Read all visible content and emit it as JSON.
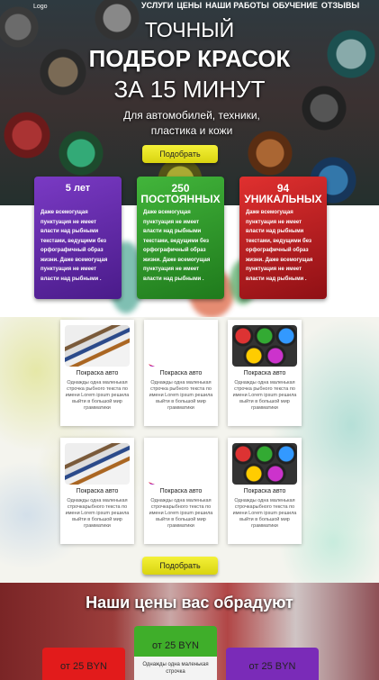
{
  "header": {
    "logo": "Logo",
    "nav": [
      "УСЛУГИ",
      "ЦЕНЫ",
      "НАШИ РАБОТЫ",
      "ОБУЧЕНИЕ",
      "ОТЗЫВЫ"
    ]
  },
  "hero": {
    "line1": "ТОЧНЫЙ",
    "line2": "ПОДБОР КРАСОК",
    "line3": "ЗА 15 МИНУТ",
    "sub": "Для автомобилей, техники, пластика и кожи",
    "button": "Подобрать"
  },
  "features": [
    {
      "title": "5 лет",
      "text": "Даже всемогущая пунктуация не имеет власти над рыбными текстами, ведущими без орфографичный образ жизни. Даже всемогущая пунктуация не имеет власти над рыбными .",
      "color": "#6a2bb0"
    },
    {
      "title": "250 ПОСТОЯННЫХ",
      "text": "Даже всемогущая пунктуация не имеет власти над рыбными текстами, ведущими без орфографичный образ жизни. Даже всемогущая пунктуация не имеет власти над рыбными .",
      "color": "#2f9a2a"
    },
    {
      "title": "94 УНИКАЛЬНЫХ",
      "text": "Даже всемогущая пунктуация не имеет власти над рыбными текстами, ведущими без орфографичный образ жизни. Даже всемогущая пунктуация не имеет власти над рыбными .",
      "color": "#c71f25"
    }
  ],
  "services": [
    {
      "title": "Покраска авто",
      "desc": "Однажды одна маленькая строчка рыбного текста по имени Lorem ipsum решила выйти в большой мир грамматики",
      "icon": "brushes-icon"
    },
    {
      "title": "Покраска авто",
      "desc": "Однажды одна маленькая строчка рыбного текста по имени Lorem ipsum решила выйти в большой мир грамматики",
      "icon": "color-fan-icon"
    },
    {
      "title": "Покраска авто",
      "desc": "Однажды одна маленькая строчка рыбного текста по имени Lorem ipsum решила выйти в большой мир грамматики",
      "icon": "spray-cans-icon"
    },
    {
      "title": "Покраска авто",
      "desc": "Однажды одна маленькая строчкарыбного текста по имени Lorem ipsum решила выйти в большой мир грамматики",
      "icon": "brushes-icon"
    },
    {
      "title": "Покраска авто",
      "desc": "Однажды одна маленькая строчкарыбного текста по имени Lorem ipsum решила выйти в большой мир грамматики",
      "icon": "color-fan-icon"
    },
    {
      "title": "Покраска авто",
      "desc": "Однажды одна маленькая строчкарыбного текста по имени Lorem ipsum решила выйти в большой мир грамматики",
      "icon": "spray-cans-icon"
    }
  ],
  "services_button": "Подобрать",
  "prices": {
    "title": "Наши цены вас обрадуют",
    "items": [
      {
        "value": "от 25 BYN",
        "color": "#e21b1b"
      },
      {
        "value": "от 25 BYN",
        "desc": "Однажды одна маленькая строчка",
        "color": "#3fae2a"
      },
      {
        "value": "от 25 BYN",
        "color": "#7a2bb8"
      }
    ]
  }
}
